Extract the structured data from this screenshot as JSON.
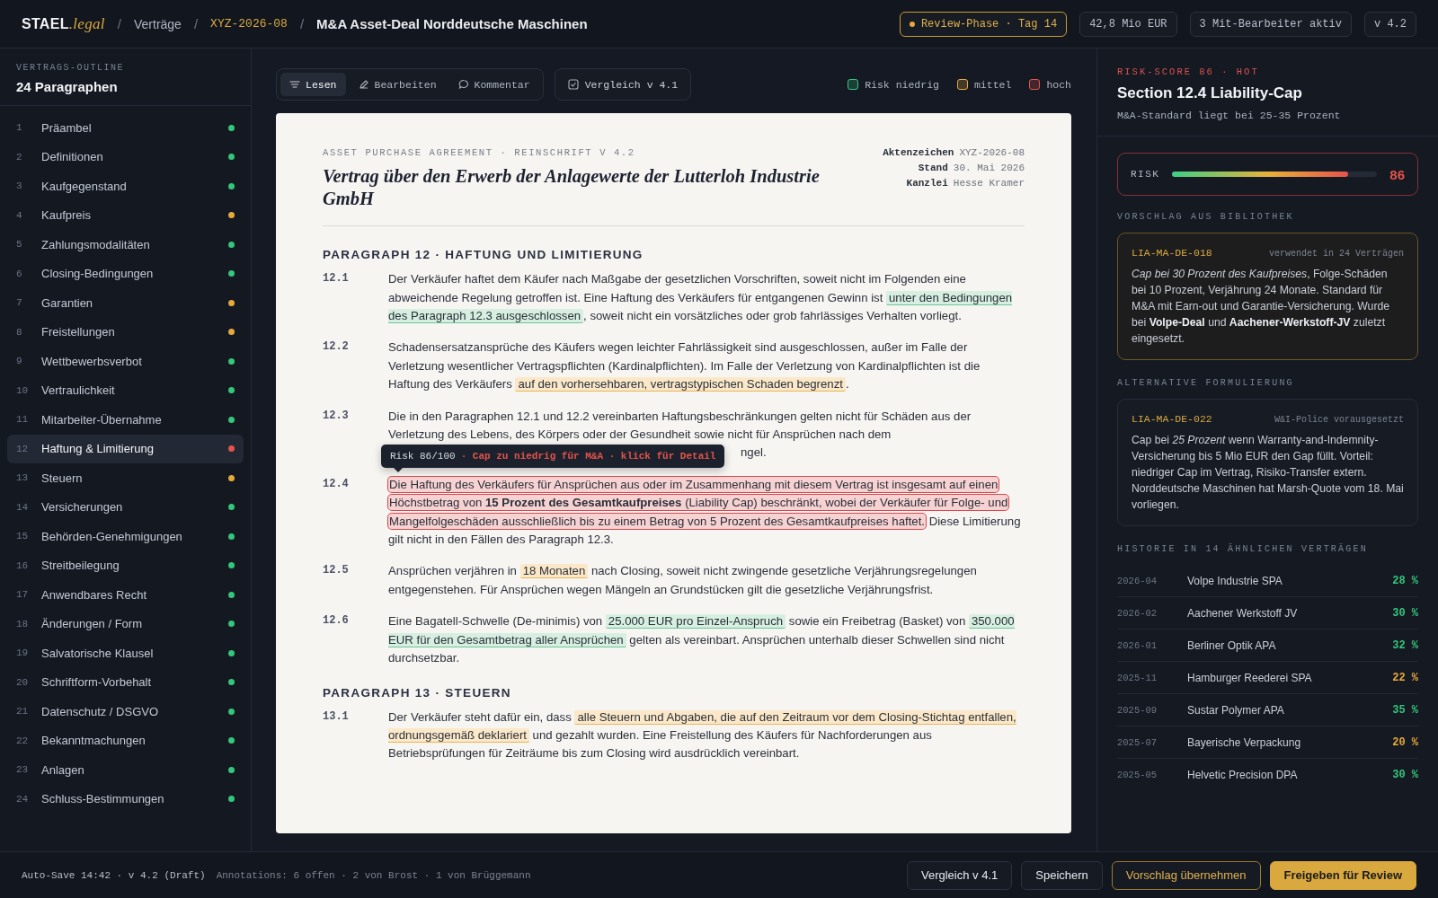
{
  "topbar": {
    "logo": {
      "brand": "STAEL",
      "suffix": ".legal"
    },
    "separator": "/",
    "breadcrumb": [
      {
        "kind": "link",
        "text": "Verträge"
      },
      {
        "kind": "code",
        "text": "XYZ-2026-08"
      },
      {
        "kind": "title",
        "text": "M&A Asset-Deal Norddeutsche Maschinen"
      }
    ],
    "status": "Review-Phase · Tag 14",
    "chips": [
      "42,8 Mio EUR",
      "3 Mit-Bearbeiter aktiv",
      "v 4.2"
    ]
  },
  "outline": {
    "caption": "VERTRAGS-OUTLINE",
    "title": "24 Paragraphen",
    "items": [
      {
        "num": "1",
        "label": "Präambel",
        "color": "#34c77b",
        "selected": false
      },
      {
        "num": "2",
        "label": "Definitionen",
        "color": "#34c77b",
        "selected": false
      },
      {
        "num": "3",
        "label": "Kaufgegenstand",
        "color": "#34c77b",
        "selected": false
      },
      {
        "num": "4",
        "label": "Kaufpreis",
        "color": "#e8a93a",
        "selected": false
      },
      {
        "num": "5",
        "label": "Zahlungsmodalitäten",
        "color": "#34c77b",
        "selected": false
      },
      {
        "num": "6",
        "label": "Closing-Bedingungen",
        "color": "#34c77b",
        "selected": false
      },
      {
        "num": "7",
        "label": "Garantien",
        "color": "#e8a93a",
        "selected": false
      },
      {
        "num": "8",
        "label": "Freistellungen",
        "color": "#e8a93a",
        "selected": false
      },
      {
        "num": "9",
        "label": "Wettbewerbsverbot",
        "color": "#34c77b",
        "selected": false
      },
      {
        "num": "10",
        "label": "Vertraulichkeit",
        "color": "#34c77b",
        "selected": false
      },
      {
        "num": "11",
        "label": "Mitarbeiter-Übernahme",
        "color": "#34c77b",
        "selected": false
      },
      {
        "num": "12",
        "label": "Haftung & Limitierung",
        "color": "#e5534b",
        "selected": true
      },
      {
        "num": "13",
        "label": "Steuern",
        "color": "#e8a93a",
        "selected": false
      },
      {
        "num": "14",
        "label": "Versicherungen",
        "color": "#34c77b",
        "selected": false
      },
      {
        "num": "15",
        "label": "Behörden-Genehmigungen",
        "color": "#34c77b",
        "selected": false
      },
      {
        "num": "16",
        "label": "Streitbeilegung",
        "color": "#34c77b",
        "selected": false
      },
      {
        "num": "17",
        "label": "Anwendbares Recht",
        "color": "#34c77b",
        "selected": false
      },
      {
        "num": "18",
        "label": "Änderungen / Form",
        "color": "#34c77b",
        "selected": false
      },
      {
        "num": "19",
        "label": "Salvatorische Klausel",
        "color": "#34c77b",
        "selected": false
      },
      {
        "num": "20",
        "label": "Schriftform-Vorbehalt",
        "color": "#34c77b",
        "selected": false
      },
      {
        "num": "21",
        "label": "Datenschutz / DSGVO",
        "color": "#34c77b",
        "selected": false
      },
      {
        "num": "22",
        "label": "Bekanntmachungen",
        "color": "#34c77b",
        "selected": false
      },
      {
        "num": "23",
        "label": "Anlagen",
        "color": "#34c77b",
        "selected": false
      },
      {
        "num": "24",
        "label": "Schluss-Bestimmungen",
        "color": "#34c77b",
        "selected": false
      }
    ]
  },
  "toolbar": {
    "modes": [
      {
        "label": "Lesen",
        "kind": "read",
        "selected": true
      },
      {
        "label": "Bearbeiten",
        "kind": "edit",
        "selected": false
      },
      {
        "label": "Kommentar",
        "kind": "comment",
        "selected": false
      }
    ],
    "compare": "Vergleich v 4.1",
    "legend": [
      {
        "label": "Risk niedrig",
        "color": "#34c77b"
      },
      {
        "label": "mittel",
        "color": "#e8a93a"
      },
      {
        "label": "hoch",
        "color": "#e5534b"
      }
    ]
  },
  "document": {
    "kicker": "ASSET PURCHASE AGREEMENT · REINSCHRIFT V 4.2",
    "title": "Vertrag über den Erwerb der Anlagewerte der Lutterloh Industrie GmbH",
    "meta": [
      {
        "label": "Aktenzeichen",
        "value": "XYZ-2026-08"
      },
      {
        "label": "Stand",
        "value": "30. Mai 2026"
      },
      {
        "label": "Kanzlei",
        "value": "Hesse Kramer"
      }
    ],
    "sections": [
      {
        "heading": "PARAGRAPH 12 · HAFTUNG UND LIMITIERUNG",
        "clauses": [
          {
            "num": "12.1",
            "segments": [
              {
                "kind": "plain",
                "text": "Der Verkäufer haftet dem Käufer nach Maßgabe der gesetzlichen Vorschriften, soweit nicht im Folgenden eine abweichende Regelung getroffen ist. Eine Haftung des Verkäufers für entgangenen Gewinn ist "
              },
              {
                "kind": "low",
                "text": "unter den Bedingungen des Paragraph 12.3 ausgeschlossen"
              },
              {
                "kind": "plain",
                "text": ", soweit nicht ein vorsätzliches oder grob fahrlässiges Verhalten vorliegt."
              }
            ]
          },
          {
            "num": "12.2",
            "segments": [
              {
                "kind": "plain",
                "text": "Schadensersatzansprüche des Käufers wegen leichter Fahrlässigkeit sind ausgeschlossen, außer im Falle der Verletzung wesentlicher Vertragspflichten (Kardinalpflichten). Im Falle der Verletzung von Kardinalpflichten ist die Haftung des Verkäufers "
              },
              {
                "kind": "mid",
                "text": "auf den vorhersehbaren, vertragstypischen Schaden begrenzt"
              },
              {
                "kind": "plain",
                "text": "."
              }
            ]
          },
          {
            "num": "12.3",
            "segments": [
              {
                "kind": "plain",
                "text": "Die in den Paragraphen 12.1 und 12.2 vereinbarten Haftungsbeschränkungen gelten nicht für Schäden aus der Verletzung des Lebens, des Körpers oder der Gesundheit sowie nicht für Ansprüchen nach dem"
              }
            ],
            "tail": "ngel."
          },
          {
            "num": "12.4",
            "tooltip": {
              "label": "Risk 86/100",
              "detail": "· Cap zu niedrig für M&A · klick für Detail"
            },
            "segments": [
              {
                "kind": "high",
                "text": "Die Haftung des Verkäufers für Ansprüchen aus oder im Zusammenhang mit diesem Vertrag ist insgesamt auf einen Höchstbetrag von **15 Prozent des Gesamtkaufpreises** (Liability Cap) beschränkt, wobei der Verkäufer für Folge- und Mangelfolgeschäden ausschließlich bis zu einem Betrag von 5 Prozent des Gesamtkaufpreises haftet."
              },
              {
                "kind": "plain",
                "text": " Diese Limitierung gilt nicht in den Fällen des Paragraph 12.3."
              }
            ]
          },
          {
            "num": "12.5",
            "segments": [
              {
                "kind": "plain",
                "text": "Ansprüchen verjähren in "
              },
              {
                "kind": "mid",
                "text": "18 Monaten"
              },
              {
                "kind": "plain",
                "text": " nach Closing, soweit nicht zwingende gesetzliche Verjährungsregelungen entgegenstehen. Für Ansprüchen wegen Mängeln an Grundstücken gilt die gesetzliche Verjährungsfrist."
              }
            ]
          },
          {
            "num": "12.6",
            "segments": [
              {
                "kind": "plain",
                "text": "Eine Bagatell-Schwelle (De-minimis) von "
              },
              {
                "kind": "low",
                "text": "25.000 EUR pro Einzel-Anspruch"
              },
              {
                "kind": "plain",
                "text": " sowie ein Freibetrag (Basket) von "
              },
              {
                "kind": "low",
                "text": "350.000 EUR für den Gesamtbetrag aller Ansprüchen"
              },
              {
                "kind": "plain",
                "text": " gelten als vereinbart. Ansprüchen unterhalb dieser Schwellen sind nicht durchsetzbar."
              }
            ]
          }
        ]
      },
      {
        "heading": "PARAGRAPH 13 · STEUERN",
        "clauses": [
          {
            "num": "13.1",
            "segments": [
              {
                "kind": "plain",
                "text": "Der Verkäufer steht dafür ein, dass "
              },
              {
                "kind": "mid",
                "text": "alle Steuern und Abgaben, die auf den Zeitraum vor dem Closing-Stichtag entfallen, ordnungsgemäß deklariert"
              },
              {
                "kind": "plain",
                "text": " und gezahlt wurden. Eine Freistellung des Käufers für Nachforderungen aus Betriebsprüfungen für Zeiträume bis zum Closing wird ausdrücklich vereinbart."
              }
            ]
          }
        ]
      }
    ]
  },
  "inspector": {
    "kicker": "RISK-SCORE 86 · HOT",
    "title": "Section 12.4 Liability-Cap",
    "subtitle": "M&A-Standard liegt bei 25-35 Prozent",
    "risk": {
      "label": "RISK",
      "level": 0.86,
      "value": "86"
    },
    "cards": [
      {
        "kind": "suggestion",
        "caption": "VORSCHLAG AUS BIBLIOTHEK",
        "code": "LIA-MA-DE-018",
        "meta": "verwendet in 24 Verträgen",
        "text": "*Cap bei 30 Prozent des Kaufpreises*, Folge-Schäden bei 10 Prozent, Verjährung 24 Monate. Standard für M&A mit Earn-out und Garantie-Versicherung. Wurde bei **Volpe-Deal** und **Aachener-Werkstoff-JV** zuletzt eingesetzt."
      },
      {
        "kind": "alternative",
        "caption": "ALTERNATIVE FORMULIERUNG",
        "code": "LIA-MA-DE-022",
        "meta": "W&I-Police vorausgesetzt",
        "text": "Cap bei *25 Prozent* wenn Warranty-and-Indemnity-Versicherung bis 5 Mio EUR den Gap füllt. Vorteil: niedriger Cap im Vertrag, Risiko-Transfer extern. Norddeutsche Maschinen hat Marsh-Quote vom 18. Mai vorliegen."
      }
    ],
    "history": {
      "caption": "HISTORIE IN 14 ÄHNLICHEN VERTRÄGEN",
      "rows": [
        {
          "date": "2026-04",
          "name": "Volpe Industrie SPA",
          "value": "28 %",
          "color": "#34c77b"
        },
        {
          "date": "2026-02",
          "name": "Aachener Werkstoff JV",
          "value": "30 %",
          "color": "#34c77b"
        },
        {
          "date": "2026-01",
          "name": "Berliner Optik APA",
          "value": "32 %",
          "color": "#34c77b"
        },
        {
          "date": "2025-11",
          "name": "Hamburger Reederei SPA",
          "value": "22 %",
          "color": "#e8a93a"
        },
        {
          "date": "2025-09",
          "name": "Sustar Polymer APA",
          "value": "35 %",
          "color": "#34c77b"
        },
        {
          "date": "2025-07",
          "name": "Bayerische Verpackung",
          "value": "20 %",
          "color": "#e8a93a"
        },
        {
          "date": "2025-05",
          "name": "Helvetic Precision DPA",
          "value": "30 %",
          "color": "#34c77b"
        }
      ]
    }
  },
  "footer": {
    "autosave": "Auto-Save 14:42 · v 4.2 (Draft)",
    "annotations": "Annotations: 6 offen · 2 von Brost · 1 von Brüggemann",
    "buttons": [
      {
        "label": "Vergleich v 4.1",
        "kind": "ghost"
      },
      {
        "label": "Speichern",
        "kind": "ghost"
      },
      {
        "label": "Vorschlag übernehmen",
        "kind": "outline"
      },
      {
        "label": "Freigeben für Review",
        "kind": "primary"
      }
    ]
  }
}
